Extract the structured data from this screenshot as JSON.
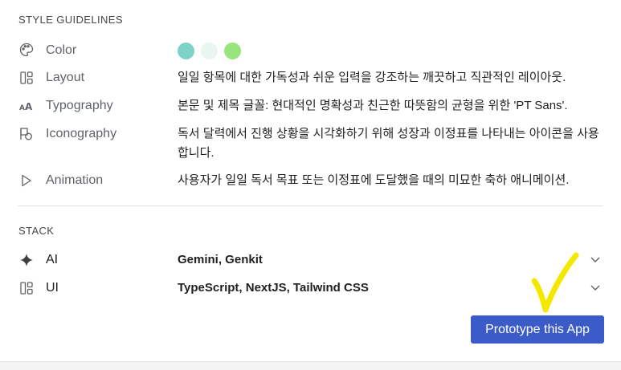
{
  "style_guidelines": {
    "heading": "STYLE GUIDELINES",
    "rows": [
      {
        "icon": "palette-icon",
        "label": "Color",
        "swatches": [
          "#7dd3c8",
          "#e8f5f0",
          "#98e57d"
        ]
      },
      {
        "icon": "layout-icon",
        "label": "Layout",
        "value": "일일 항목에 대한 가독성과 쉬운 입력을 강조하는 깨끗하고 직관적인 레이아웃."
      },
      {
        "icon": "typography-icon",
        "label": "Typography",
        "value": "본문 및 제목 글꼴: 현대적인 명확성과 친근한 따뜻함의 균형을 위한 'PT Sans'."
      },
      {
        "icon": "iconography-icon",
        "label": "Iconography",
        "value": "독서 달력에서 진행 상황을 시각화하기 위해 성장과 이정표를 나타내는 아이콘을 사용합니다."
      },
      {
        "icon": "play-icon",
        "label": "Animation",
        "value": "사용자가 일일 독서 목표 또는 이정표에 도달했을 때의 미묘한 축하 애니메이션."
      }
    ]
  },
  "stack": {
    "heading": "STACK",
    "rows": [
      {
        "icon": "sparkle-icon",
        "label": "AI",
        "value": "Gemini, Genkit"
      },
      {
        "icon": "layout-icon",
        "label": "UI",
        "value": "TypeScript, NextJS, Tailwind CSS"
      }
    ]
  },
  "cta": {
    "label": "Prototype this App"
  },
  "colors": {
    "accent": "#3b5cc8",
    "checkmark": "#f5e800"
  }
}
